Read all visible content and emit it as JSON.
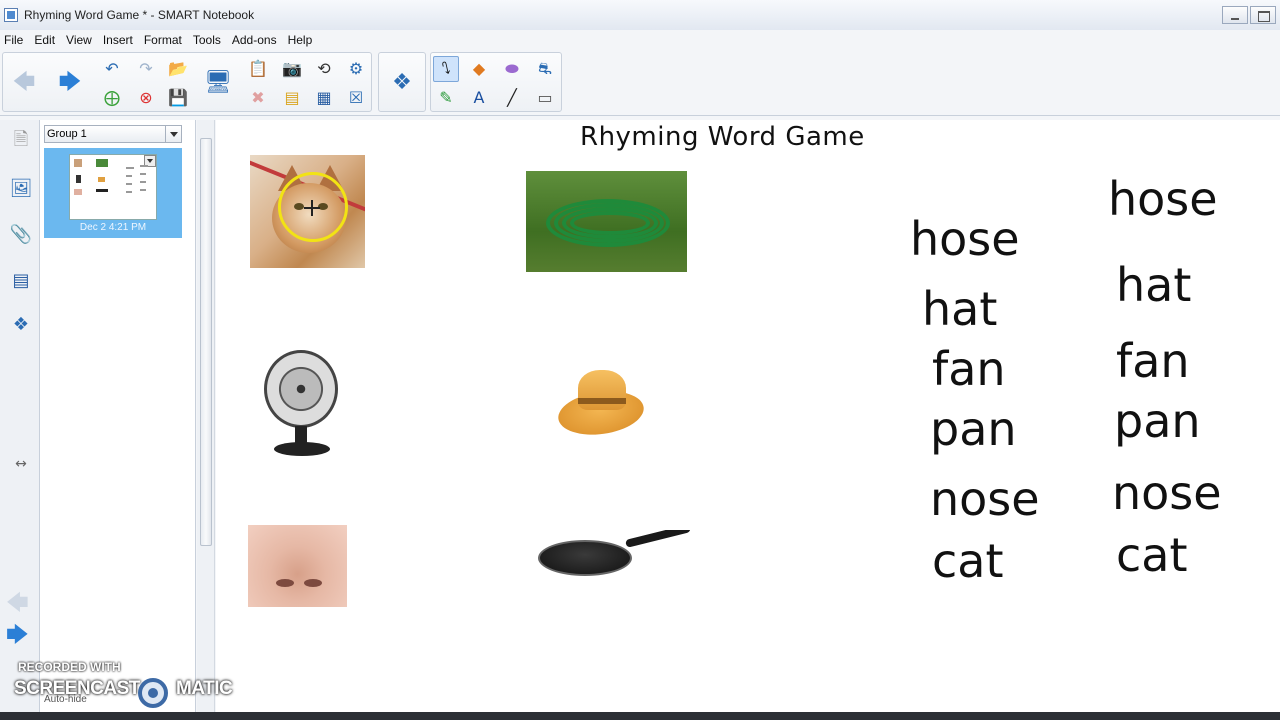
{
  "window": {
    "title": "Rhyming Word Game * - SMART Notebook"
  },
  "menu": [
    "File",
    "Edit",
    "View",
    "Insert",
    "Format",
    "Tools",
    "Add-ons",
    "Help"
  ],
  "sorter": {
    "group_label": "Group 1",
    "thumbnail_date": "Dec 2 4:21 PM"
  },
  "page": {
    "title": "Rhyming Word Game",
    "words_left": [
      "hose",
      "hat",
      "fan",
      "pan",
      "nose",
      "cat"
    ],
    "words_right": [
      "hose",
      "hat",
      "fan",
      "pan",
      "nose",
      "cat"
    ]
  },
  "watermark": {
    "line1": "RECORDED WITH",
    "line2": "SCREENCAST",
    "line3": "MATIC"
  },
  "autohide": "Auto-hide",
  "colors": {
    "selection_highlight": "#f2e314",
    "thumbnail_bg": "#6bb8ef",
    "nav_arrow": "#2b7fd6"
  }
}
